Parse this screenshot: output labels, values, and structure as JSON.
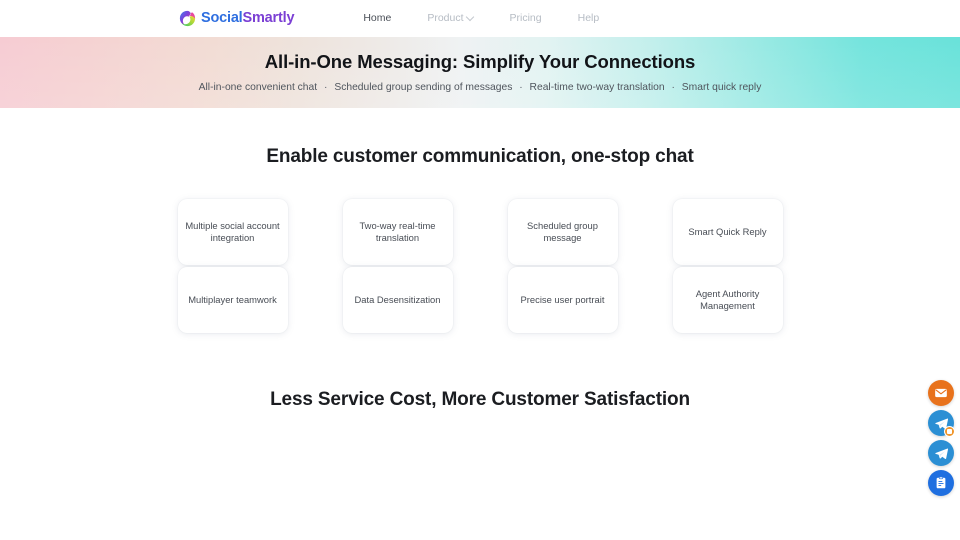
{
  "nav": {
    "brand": {
      "icon": "swirl-logo-icon",
      "text_primary": "Social",
      "text_secondary": "Smartly"
    },
    "links": [
      {
        "label": "Home",
        "active": true,
        "has_caret": false
      },
      {
        "label": "Product",
        "active": false,
        "has_caret": true,
        "caret_icon": "chevron-down-icon"
      },
      {
        "label": "Pricing",
        "active": false,
        "has_caret": false
      },
      {
        "label": "Help",
        "active": false,
        "has_caret": false
      }
    ]
  },
  "hero": {
    "title": "All-in-One Messaging: Simplify Your Connections",
    "subtitle_parts": [
      "All-in-one convenient chat",
      "Scheduled group sending of messages",
      "Real-time two-way translation",
      "Smart quick reply"
    ],
    "separator": "·",
    "gradient_start": "#f6ccd3",
    "gradient_mid": "#eff2f3",
    "gradient_end": "#69e2da"
  },
  "main": {
    "section_one_title": "Enable customer communication, one-stop chat",
    "section_two_title": "Less Service Cost, More Customer Satisfaction",
    "feature_columns": [
      {
        "cards": [
          {
            "label": "Multiple social account integration"
          },
          {
            "label": "Multiplayer teamwork"
          }
        ]
      },
      {
        "cards": [
          {
            "label": "Two-way real-time translation"
          },
          {
            "label": "Data Desensitization"
          }
        ]
      },
      {
        "cards": [
          {
            "label": "Scheduled group message"
          },
          {
            "label": "Precise user portrait"
          }
        ]
      },
      {
        "cards": [
          {
            "label": "Smart Quick Reply"
          },
          {
            "label": "Agent Authority Management"
          }
        ]
      }
    ]
  },
  "floating_buttons": [
    {
      "icon": "envelope-icon",
      "color": "#e8721c",
      "badge": false
    },
    {
      "icon": "telegram-icon",
      "color": "#2b8fd4",
      "badge": true,
      "badge_color": "#f0952b"
    },
    {
      "icon": "telegram-icon",
      "color": "#2b8fd4",
      "badge": false
    },
    {
      "icon": "note-edit-icon",
      "color": "#1f6fe0",
      "badge": false
    }
  ]
}
